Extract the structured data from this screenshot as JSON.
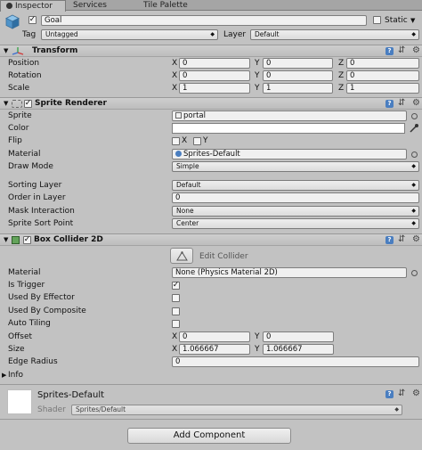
{
  "tabs": [
    {
      "label": "Inspector",
      "active": true
    },
    {
      "label": "Services",
      "active": false
    },
    {
      "label": "Tile Palette",
      "active": false
    }
  ],
  "gameobject": {
    "name": "Goal",
    "static_label": "Static",
    "tag_label": "Tag",
    "tag_value": "Untagged",
    "layer_label": "Layer",
    "layer_value": "Default"
  },
  "transform": {
    "title": "Transform",
    "position": {
      "label": "Position",
      "x": "0",
      "y": "0",
      "z": "0"
    },
    "rotation": {
      "label": "Rotation",
      "x": "0",
      "y": "0",
      "z": "0"
    },
    "scale": {
      "label": "Scale",
      "x": "1",
      "y": "1",
      "z": "1"
    },
    "axis_x": "X",
    "axis_y": "Y",
    "axis_z": "Z"
  },
  "sprite_renderer": {
    "title": "Sprite Renderer",
    "sprite_label": "Sprite",
    "sprite_value": "portal",
    "color_label": "Color",
    "flip_label": "Flip",
    "flip_x": "X",
    "flip_y": "Y",
    "material_label": "Material",
    "material_value": "Sprites-Default",
    "draw_mode_label": "Draw Mode",
    "draw_mode_value": "Simple",
    "sorting_layer_label": "Sorting Layer",
    "sorting_layer_value": "Default",
    "order_label": "Order in Layer",
    "order_value": "0",
    "mask_label": "Mask Interaction",
    "mask_value": "None",
    "sort_point_label": "Sprite Sort Point",
    "sort_point_value": "Center"
  },
  "box_collider": {
    "title": "Box Collider 2D",
    "edit_collider_label": "Edit Collider",
    "material_label": "Material",
    "material_value": "None (Physics Material 2D)",
    "is_trigger_label": "Is Trigger",
    "is_trigger": true,
    "used_by_effector_label": "Used By Effector",
    "used_by_composite_label": "Used By Composite",
    "auto_tiling_label": "Auto Tiling",
    "offset_label": "Offset",
    "offset_x": "0",
    "offset_y": "0",
    "size_label": "Size",
    "size_x": "1.066667",
    "size_y": "1.066667",
    "edge_radius_label": "Edge Radius",
    "edge_radius_value": "0",
    "info_label": "Info",
    "axis_x": "X",
    "axis_y": "Y"
  },
  "material_preview": {
    "name": "Sprites-Default",
    "shader_label": "Shader",
    "shader_value": "Sprites/Default"
  },
  "add_component_label": "Add Component",
  "colors": {
    "panel_bg": "#c2c2c2",
    "accent_blue": "#4a7ec0",
    "tab_bar": "#a5a5a5"
  }
}
